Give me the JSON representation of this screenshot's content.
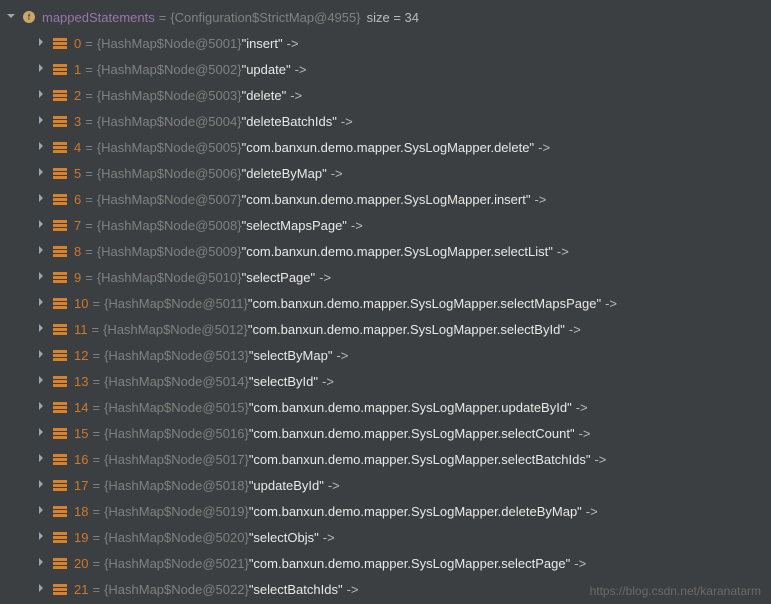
{
  "root": {
    "varName": "mappedStatements",
    "objRef": "{Configuration$StrictMap@4955}",
    "sizeLabel": "size = 34"
  },
  "entries": [
    {
      "index": "0",
      "nodeRef": "{HashMap$Node@5001}",
      "key": "\"insert\""
    },
    {
      "index": "1",
      "nodeRef": "{HashMap$Node@5002}",
      "key": "\"update\""
    },
    {
      "index": "2",
      "nodeRef": "{HashMap$Node@5003}",
      "key": "\"delete\""
    },
    {
      "index": "3",
      "nodeRef": "{HashMap$Node@5004}",
      "key": "\"deleteBatchIds\""
    },
    {
      "index": "4",
      "nodeRef": "{HashMap$Node@5005}",
      "key": "\"com.banxun.demo.mapper.SysLogMapper.delete\""
    },
    {
      "index": "5",
      "nodeRef": "{HashMap$Node@5006}",
      "key": "\"deleteByMap\""
    },
    {
      "index": "6",
      "nodeRef": "{HashMap$Node@5007}",
      "key": "\"com.banxun.demo.mapper.SysLogMapper.insert\""
    },
    {
      "index": "7",
      "nodeRef": "{HashMap$Node@5008}",
      "key": "\"selectMapsPage\""
    },
    {
      "index": "8",
      "nodeRef": "{HashMap$Node@5009}",
      "key": "\"com.banxun.demo.mapper.SysLogMapper.selectList\""
    },
    {
      "index": "9",
      "nodeRef": "{HashMap$Node@5010}",
      "key": "\"selectPage\""
    },
    {
      "index": "10",
      "nodeRef": "{HashMap$Node@5011}",
      "key": "\"com.banxun.demo.mapper.SysLogMapper.selectMapsPage\""
    },
    {
      "index": "11",
      "nodeRef": "{HashMap$Node@5012}",
      "key": "\"com.banxun.demo.mapper.SysLogMapper.selectById\""
    },
    {
      "index": "12",
      "nodeRef": "{HashMap$Node@5013}",
      "key": "\"selectByMap\""
    },
    {
      "index": "13",
      "nodeRef": "{HashMap$Node@5014}",
      "key": "\"selectById\""
    },
    {
      "index": "14",
      "nodeRef": "{HashMap$Node@5015}",
      "key": "\"com.banxun.demo.mapper.SysLogMapper.updateById\""
    },
    {
      "index": "15",
      "nodeRef": "{HashMap$Node@5016}",
      "key": "\"com.banxun.demo.mapper.SysLogMapper.selectCount\""
    },
    {
      "index": "16",
      "nodeRef": "{HashMap$Node@5017}",
      "key": "\"com.banxun.demo.mapper.SysLogMapper.selectBatchIds\""
    },
    {
      "index": "17",
      "nodeRef": "{HashMap$Node@5018}",
      "key": "\"updateById\""
    },
    {
      "index": "18",
      "nodeRef": "{HashMap$Node@5019}",
      "key": "\"com.banxun.demo.mapper.SysLogMapper.deleteByMap\""
    },
    {
      "index": "19",
      "nodeRef": "{HashMap$Node@5020}",
      "key": "\"selectObjs\""
    },
    {
      "index": "20",
      "nodeRef": "{HashMap$Node@5021}",
      "key": "\"com.banxun.demo.mapper.SysLogMapper.selectPage\""
    },
    {
      "index": "21",
      "nodeRef": "{HashMap$Node@5022}",
      "key": "\"selectBatchIds\""
    }
  ],
  "arrowSuffix": "->",
  "watermark": "https://blog.csdn.net/karanatarm"
}
